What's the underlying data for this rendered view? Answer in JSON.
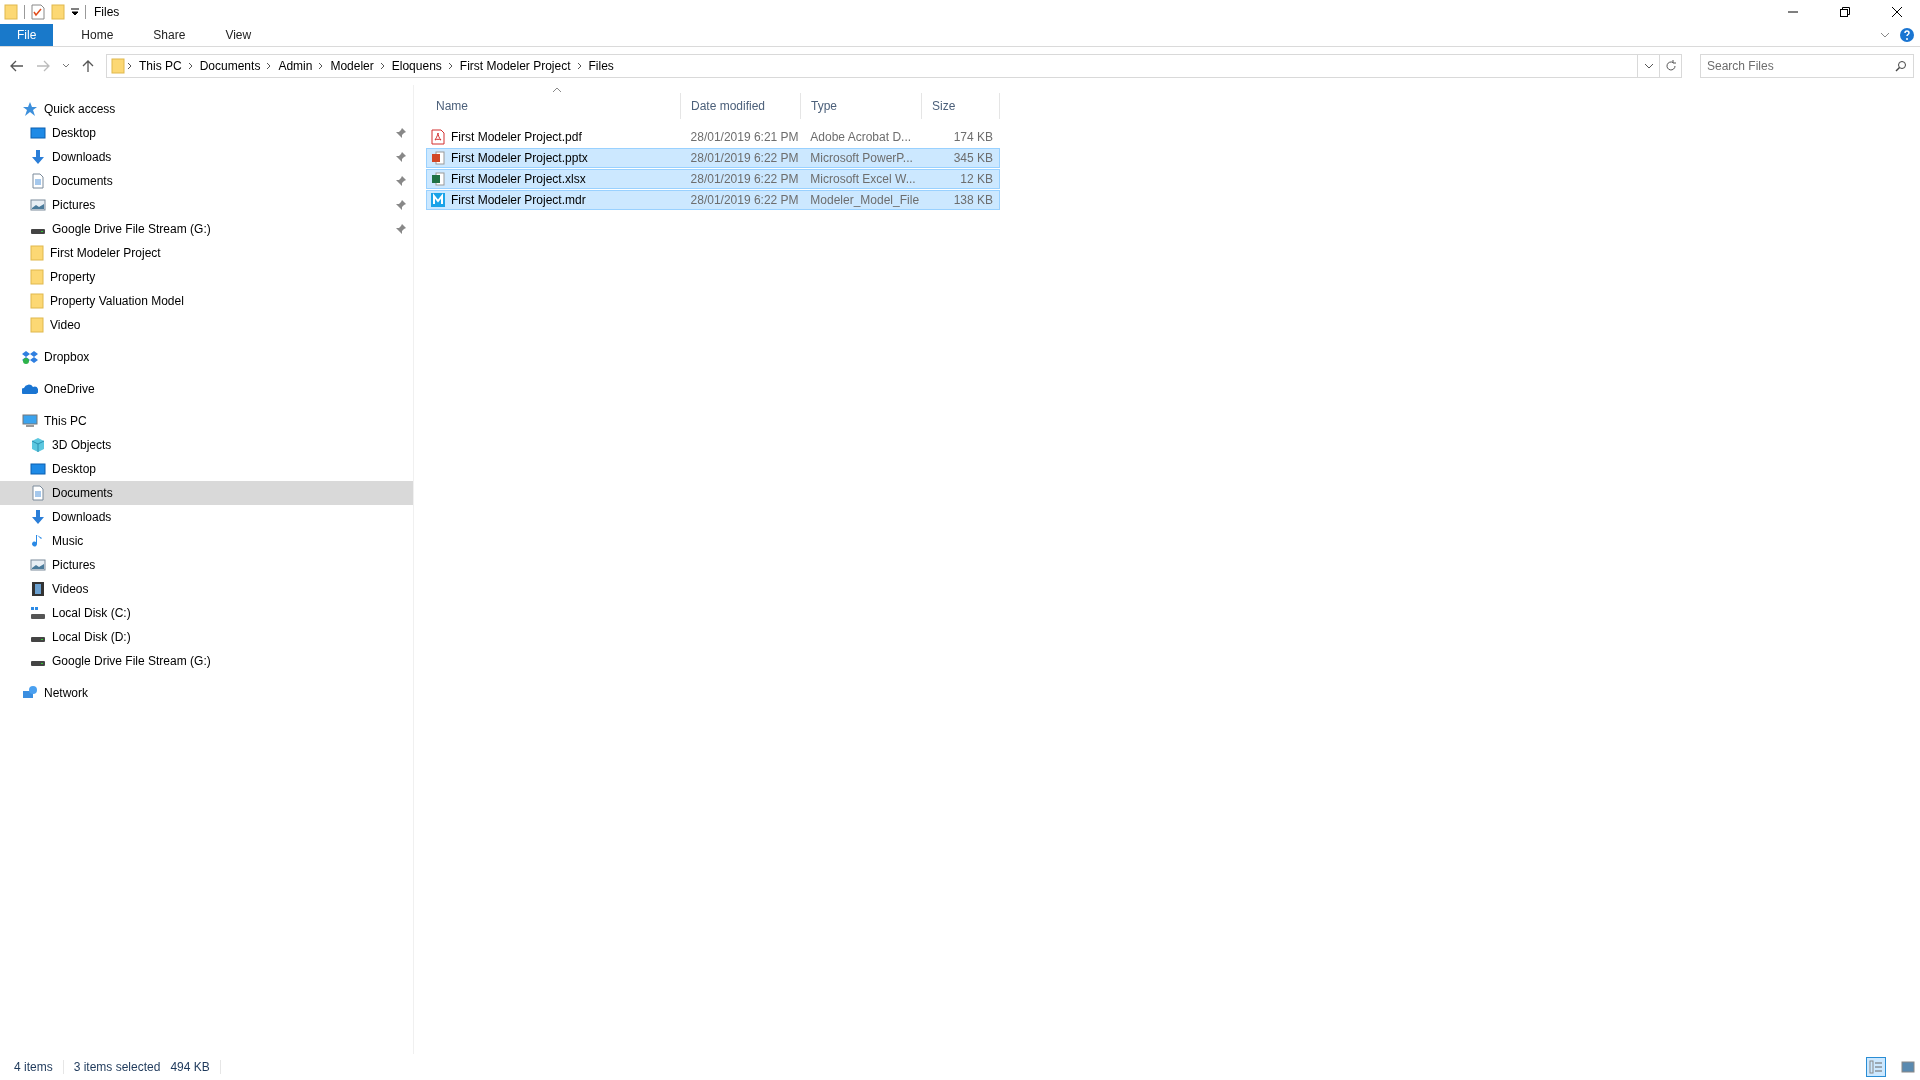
{
  "window": {
    "title": "Files"
  },
  "ribbon_tabs": [
    {
      "label": "File",
      "kind": "menu"
    },
    {
      "label": "Home",
      "kind": "tab"
    },
    {
      "label": "Share",
      "kind": "tab"
    },
    {
      "label": "View",
      "kind": "tab"
    }
  ],
  "breadcrumb": [
    "This PC",
    "Documents",
    "Admin",
    "Modeler",
    "Eloquens",
    "First Modeler Project",
    "Files"
  ],
  "search": {
    "placeholder": "Search Files"
  },
  "sidebar": {
    "items": [
      {
        "label": "Quick access",
        "kind": "star",
        "selected": false,
        "children": [
          {
            "label": "Desktop",
            "kind": "desktop",
            "pinned": true,
            "selected": false
          },
          {
            "label": "Downloads",
            "kind": "download",
            "pinned": true,
            "selected": false
          },
          {
            "label": "Documents",
            "kind": "document",
            "pinned": true,
            "selected": false
          },
          {
            "label": "Pictures",
            "kind": "picture",
            "pinned": true,
            "selected": false
          },
          {
            "label": "Google Drive File Stream (G:)",
            "kind": "drive",
            "pinned": true,
            "selected": false
          },
          {
            "label": "First Modeler Project",
            "kind": "folder",
            "pinned": false,
            "selected": false
          },
          {
            "label": "Property",
            "kind": "folder",
            "pinned": false,
            "selected": false
          },
          {
            "label": "Property Valuation Model",
            "kind": "folder",
            "pinned": false,
            "selected": false
          },
          {
            "label": "Video",
            "kind": "folder",
            "pinned": false,
            "selected": false
          }
        ]
      },
      {
        "label": "Dropbox",
        "kind": "dropbox",
        "selected": false
      },
      {
        "label": "OneDrive",
        "kind": "cloud",
        "selected": false
      },
      {
        "label": "This PC",
        "kind": "monitor",
        "selected": false,
        "children": [
          {
            "label": "3D Objects",
            "kind": "cube",
            "pinned": false,
            "selected": false
          },
          {
            "label": "Desktop",
            "kind": "desktop",
            "pinned": false,
            "selected": false
          },
          {
            "label": "Documents",
            "kind": "document",
            "pinned": false,
            "selected": true
          },
          {
            "label": "Downloads",
            "kind": "download",
            "pinned": false,
            "selected": false
          },
          {
            "label": "Music",
            "kind": "music",
            "pinned": false,
            "selected": false
          },
          {
            "label": "Pictures",
            "kind": "picture",
            "pinned": false,
            "selected": false
          },
          {
            "label": "Videos",
            "kind": "film",
            "pinned": false,
            "selected": false
          },
          {
            "label": "Local Disk (C:)",
            "kind": "system-drive",
            "pinned": false,
            "selected": false
          },
          {
            "label": "Local Disk (D:)",
            "kind": "drive",
            "pinned": false,
            "selected": false
          },
          {
            "label": "Google Drive File Stream (G:)",
            "kind": "drive",
            "pinned": false,
            "selected": false
          }
        ]
      },
      {
        "label": "Network",
        "kind": "network",
        "selected": false
      }
    ]
  },
  "table": {
    "columns": [
      {
        "label": "Name",
        "sorted": true
      },
      {
        "label": "Date modified",
        "sorted": false
      },
      {
        "label": "Type",
        "sorted": false
      },
      {
        "label": "Size",
        "sorted": false
      }
    ],
    "rows": [
      {
        "name": "First Modeler Project.pdf",
        "kind": "pdf",
        "date": "28/01/2019 6:21 PM",
        "type": "Adobe Acrobat D...",
        "size": "174 KB",
        "selected": false
      },
      {
        "name": "First Modeler Project.pptx",
        "kind": "pptx",
        "date": "28/01/2019 6:22 PM",
        "type": "Microsoft PowerP...",
        "size": "345 KB",
        "selected": true
      },
      {
        "name": "First Modeler Project.xlsx",
        "kind": "xlsx",
        "date": "28/01/2019 6:22 PM",
        "type": "Microsoft Excel W...",
        "size": "12 KB",
        "selected": true
      },
      {
        "name": "First Modeler Project.mdr",
        "kind": "letter",
        "date": "28/01/2019 6:22 PM",
        "type": "Modeler_Model_File",
        "size": "138 KB",
        "selected": true
      }
    ]
  },
  "status_bar": {
    "count": "4 items",
    "selection": "3 items selected",
    "selection_size": "494 KB"
  },
  "view_buttons": [
    {
      "kind": "details",
      "selected": true
    },
    {
      "kind": "thumbnails",
      "selected": false
    }
  ]
}
